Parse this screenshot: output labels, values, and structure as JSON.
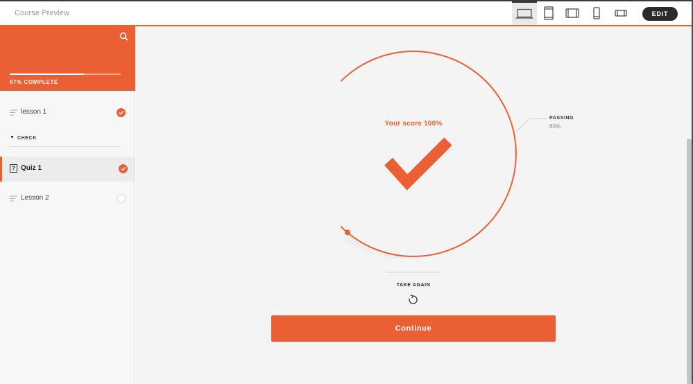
{
  "header": {
    "title": "Course Preview",
    "devices": [
      {
        "icon": "laptop-icon",
        "active": true
      },
      {
        "icon": "tablet-portrait-icon",
        "active": false
      },
      {
        "icon": "tablet-landscape-icon",
        "active": false
      },
      {
        "icon": "phone-portrait-icon",
        "active": false
      },
      {
        "icon": "phone-landscape-icon",
        "active": false
      }
    ],
    "edit_label": "EDIT"
  },
  "sidebar": {
    "progress_label": "67% COMPLETE",
    "progress_fraction": 0.67,
    "items": [
      {
        "label": "lesson 1",
        "status": "complete"
      },
      {
        "label": "Quiz 1",
        "status": "complete",
        "active": true
      },
      {
        "label": "Lesson 2",
        "status": "incomplete"
      }
    ],
    "section": {
      "label": "CHECK"
    }
  },
  "result": {
    "score_label": "Your score 100%",
    "score_fraction": 1.0,
    "passing_label": "PASSING",
    "passing_value": "80%",
    "passing_fraction": 0.8,
    "take_again_label": "TAKE AGAIN",
    "continue_label": "Continue"
  },
  "colors": {
    "accent": "#ea5f33",
    "dark": "#2b2b2b",
    "main_bg": "#f4f4f4"
  }
}
